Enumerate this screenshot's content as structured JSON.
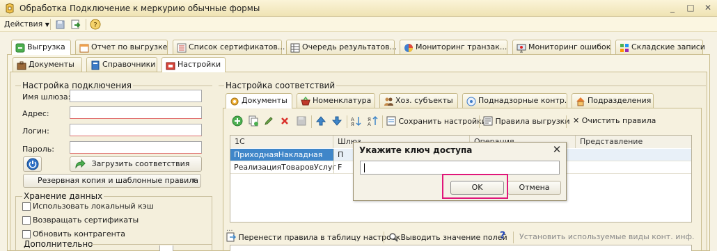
{
  "window": {
    "title": "Обработка  Подключение к меркурию обычные формы",
    "controls": [
      "_",
      "□",
      "✕"
    ]
  },
  "menubar": {
    "actions_label": "Действия"
  },
  "main_tabs": [
    {
      "label": "Выгрузка",
      "active": true
    },
    {
      "label": "Отчет по выгрузке"
    },
    {
      "label": "Список сертификатов..."
    },
    {
      "label": "Очередь результатов..."
    },
    {
      "label": "Мониторинг транзак..."
    },
    {
      "label": "Мониторинг ошибок"
    },
    {
      "label": "Складские записи"
    }
  ],
  "sub_tabs": [
    {
      "label": "Документы"
    },
    {
      "label": "Справочники"
    },
    {
      "label": "Настройки",
      "active": true
    }
  ],
  "connection": {
    "title": "Настройка подключения",
    "gateway_label": "Имя шлюза:",
    "address_label": "Адрес:",
    "login_label": "Логин:",
    "password_label": "Пароль:",
    "load_button": "Загрузить соответствия",
    "backup_button": "Резервная копия и шаблонные правила"
  },
  "storage": {
    "title": "Хранение данных",
    "options": [
      "Использовать локальный кэш",
      "Возвращать сертификаты",
      "Обновить контрагента"
    ]
  },
  "additional": {
    "title": "Дополнительно"
  },
  "mapping": {
    "title": "Настройка соответствий",
    "tabs": [
      {
        "label": "Документы",
        "active": true
      },
      {
        "label": "Номенклатура"
      },
      {
        "label": "Хоз. субъекты"
      },
      {
        "label": "Поднадзорные контр."
      },
      {
        "label": "Подразделения"
      }
    ],
    "toolbar": {
      "save_settings": "Сохранить настройки",
      "export_rules": "Правила выгрузки",
      "clear_rules": "Очистить правила"
    },
    "columns": [
      "1С",
      "Шлюз",
      "Операция",
      "Представление"
    ],
    "rows": [
      {
        "c1": "ПриходнаяНакладная",
        "c2": "П",
        "selected": true
      },
      {
        "c1": "РеализацияТоваровУслуг",
        "c2": "F",
        "selected": false
      }
    ],
    "bottom": {
      "transfer_rules": "Перенести правила в таблицу настроек",
      "output_fields": "Выводить значение полей",
      "help": "?",
      "set_types": "Установить используемые виды конт. инф."
    }
  },
  "dialog": {
    "title": "Укажите ключ доступа",
    "input_value": "",
    "ok": "OK",
    "cancel": "Отмена"
  },
  "colors": {
    "highlight": "#e0167a",
    "selected_row": "#3f86c9",
    "required_underline": "#e06a6a"
  }
}
